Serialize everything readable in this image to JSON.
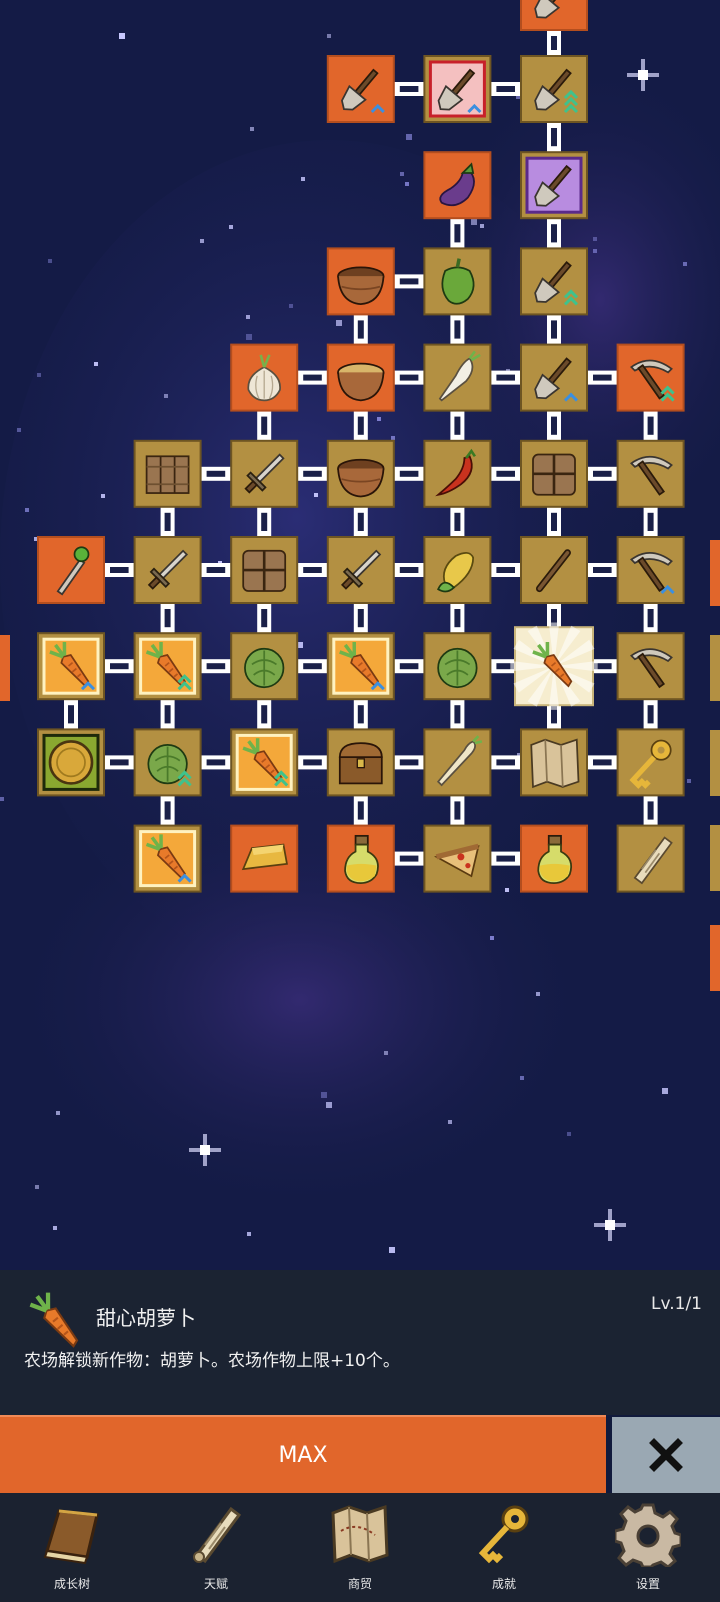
{
  "tree": {
    "nodes": [
      {
        "id": "a1",
        "col": 5,
        "row": 0,
        "icon": "shovel-icon",
        "style": "orange",
        "partial": true
      },
      {
        "id": "b3",
        "col": 3,
        "row": 1,
        "icon": "shovel-icon",
        "style": "orange",
        "arrows": 1
      },
      {
        "id": "b4",
        "col": 4,
        "row": 1,
        "icon": "shovel-icon",
        "style": "pink-frame",
        "arrows": 1
      },
      {
        "id": "b5",
        "col": 5,
        "row": 1,
        "icon": "shovel-icon",
        "style": "tan",
        "arrows": 3
      },
      {
        "id": "c4",
        "col": 4,
        "row": 2,
        "icon": "eggplant-icon",
        "style": "orange"
      },
      {
        "id": "c5",
        "col": 5,
        "row": 2,
        "icon": "shovel-icon",
        "style": "purple-frame"
      },
      {
        "id": "d3",
        "col": 3,
        "row": 3,
        "icon": "bowl-icon",
        "style": "orange"
      },
      {
        "id": "d4",
        "col": 4,
        "row": 3,
        "icon": "pepper-icon",
        "style": "tan"
      },
      {
        "id": "d5",
        "col": 5,
        "row": 3,
        "icon": "shovel-icon",
        "style": "tan",
        "arrows": 2
      },
      {
        "id": "e2",
        "col": 2,
        "row": 4,
        "icon": "garlic-icon",
        "style": "orange"
      },
      {
        "id": "e3",
        "col": 3,
        "row": 4,
        "icon": "soup-bowl-icon",
        "style": "orange"
      },
      {
        "id": "e4",
        "col": 4,
        "row": 4,
        "icon": "radish-icon",
        "style": "tan"
      },
      {
        "id": "e5",
        "col": 5,
        "row": 4,
        "icon": "shovel-icon",
        "style": "tan",
        "arrows": 1
      },
      {
        "id": "e6",
        "col": 6,
        "row": 4,
        "icon": "pickaxe-icon",
        "style": "orange",
        "arrows": 2
      },
      {
        "id": "f1",
        "col": 1,
        "row": 5,
        "icon": "wood-planks-icon",
        "style": "tan"
      },
      {
        "id": "f2",
        "col": 2,
        "row": 5,
        "icon": "sword-icon",
        "style": "tan"
      },
      {
        "id": "f3",
        "col": 3,
        "row": 5,
        "icon": "bowl-icon",
        "style": "tan"
      },
      {
        "id": "f4",
        "col": 4,
        "row": 5,
        "icon": "chili-icon",
        "style": "tan"
      },
      {
        "id": "f5",
        "col": 5,
        "row": 5,
        "icon": "crate-icon",
        "style": "tan"
      },
      {
        "id": "f6",
        "col": 6,
        "row": 5,
        "icon": "pickaxe-icon",
        "style": "tan"
      },
      {
        "id": "g0",
        "col": 0,
        "row": 6,
        "icon": "staff-icon",
        "style": "orange"
      },
      {
        "id": "g1",
        "col": 1,
        "row": 6,
        "icon": "sword-icon",
        "style": "tan"
      },
      {
        "id": "g2",
        "col": 2,
        "row": 6,
        "icon": "crate-icon",
        "style": "tan"
      },
      {
        "id": "g3",
        "col": 3,
        "row": 6,
        "icon": "sword-icon",
        "style": "tan"
      },
      {
        "id": "g4",
        "col": 4,
        "row": 6,
        "icon": "corn-icon",
        "style": "tan"
      },
      {
        "id": "g5",
        "col": 5,
        "row": 6,
        "icon": "stick-icon",
        "style": "tan"
      },
      {
        "id": "g6",
        "col": 6,
        "row": 6,
        "icon": "pickaxe-icon",
        "style": "tan",
        "arrows": 1
      },
      {
        "id": "h0",
        "col": 0,
        "row": 7,
        "icon": "carrot-icon",
        "style": "gold-frame",
        "arrows": 1
      },
      {
        "id": "h1",
        "col": 1,
        "row": 7,
        "icon": "carrot-icon",
        "style": "gold-frame",
        "arrows": 2
      },
      {
        "id": "h2",
        "col": 2,
        "row": 7,
        "icon": "cabbage-icon",
        "style": "tan"
      },
      {
        "id": "h3",
        "col": 3,
        "row": 7,
        "icon": "carrot-icon",
        "style": "gold-frame",
        "arrows": 1
      },
      {
        "id": "h4",
        "col": 4,
        "row": 7,
        "icon": "cabbage-icon",
        "style": "tan"
      },
      {
        "id": "h5",
        "col": 5,
        "row": 7,
        "icon": "carrot-icon",
        "style": "selected"
      },
      {
        "id": "h6",
        "col": 6,
        "row": 7,
        "icon": "pickaxe-icon",
        "style": "tan"
      },
      {
        "id": "i0",
        "col": 0,
        "row": 8,
        "icon": "coin-icon",
        "style": "green-frame"
      },
      {
        "id": "i1",
        "col": 1,
        "row": 8,
        "icon": "cabbage-icon",
        "style": "tan",
        "arrows": 2
      },
      {
        "id": "i2",
        "col": 2,
        "row": 8,
        "icon": "carrot-icon",
        "style": "gold-frame",
        "arrows": 2
      },
      {
        "id": "i3",
        "col": 3,
        "row": 8,
        "icon": "chest-icon",
        "style": "tan"
      },
      {
        "id": "i4",
        "col": 4,
        "row": 8,
        "icon": "parsnip-icon",
        "style": "tan"
      },
      {
        "id": "i5",
        "col": 5,
        "row": 8,
        "icon": "map-icon",
        "style": "tan"
      },
      {
        "id": "i6",
        "col": 6,
        "row": 8,
        "icon": "key-icon",
        "style": "tan"
      },
      {
        "id": "j1",
        "col": 1,
        "row": 9,
        "icon": "carrot-icon",
        "style": "gold-frame",
        "arrows": 1
      },
      {
        "id": "j2",
        "col": 2,
        "row": 9,
        "icon": "gold-bar-icon",
        "style": "orange"
      },
      {
        "id": "j3",
        "col": 3,
        "row": 9,
        "icon": "potion-icon",
        "style": "orange"
      },
      {
        "id": "j4",
        "col": 4,
        "row": 9,
        "icon": "pizza-icon",
        "style": "tan"
      },
      {
        "id": "j5",
        "col": 5,
        "row": 9,
        "icon": "potion-icon",
        "style": "orange"
      },
      {
        "id": "j6",
        "col": 6,
        "row": 9,
        "icon": "scroll-icon",
        "style": "tan"
      }
    ],
    "links": [
      [
        "a1",
        "b5"
      ],
      [
        "b3",
        "b4"
      ],
      [
        "b4",
        "b5"
      ],
      [
        "b5",
        "c5"
      ],
      [
        "c4",
        "d4"
      ],
      [
        "c5",
        "d5"
      ],
      [
        "d3",
        "d4"
      ],
      [
        "d3",
        "e3"
      ],
      [
        "d4",
        "e4"
      ],
      [
        "d5",
        "e5"
      ],
      [
        "e2",
        "e3"
      ],
      [
        "e3",
        "e4"
      ],
      [
        "e4",
        "e5"
      ],
      [
        "e5",
        "e6"
      ],
      [
        "e2",
        "f2"
      ],
      [
        "e3",
        "f3"
      ],
      [
        "e4",
        "f4"
      ],
      [
        "e5",
        "f5"
      ],
      [
        "e6",
        "f6"
      ],
      [
        "f1",
        "f2"
      ],
      [
        "f2",
        "f3"
      ],
      [
        "f3",
        "f4"
      ],
      [
        "f4",
        "f5"
      ],
      [
        "f5",
        "f6"
      ],
      [
        "f1",
        "g1"
      ],
      [
        "f2",
        "g2"
      ],
      [
        "f3",
        "g3"
      ],
      [
        "f4",
        "g4"
      ],
      [
        "f5",
        "g5"
      ],
      [
        "f6",
        "g6"
      ],
      [
        "g0",
        "g1"
      ],
      [
        "g1",
        "g2"
      ],
      [
        "g2",
        "g3"
      ],
      [
        "g3",
        "g4"
      ],
      [
        "g4",
        "g5"
      ],
      [
        "g5",
        "g6"
      ],
      [
        "g1",
        "h1"
      ],
      [
        "g2",
        "h2"
      ],
      [
        "g3",
        "h3"
      ],
      [
        "g4",
        "h4"
      ],
      [
        "g5",
        "h5"
      ],
      [
        "g6",
        "h6"
      ],
      [
        "h0",
        "h1"
      ],
      [
        "h1",
        "h2"
      ],
      [
        "h2",
        "h3"
      ],
      [
        "h3",
        "h4"
      ],
      [
        "h4",
        "h5"
      ],
      [
        "h5",
        "h6"
      ],
      [
        "h0",
        "i0"
      ],
      [
        "h1",
        "i1"
      ],
      [
        "h2",
        "i2"
      ],
      [
        "h3",
        "i3"
      ],
      [
        "h4",
        "i4"
      ],
      [
        "h5",
        "i5"
      ],
      [
        "h6",
        "i6"
      ],
      [
        "i0",
        "i1"
      ],
      [
        "i1",
        "i2"
      ],
      [
        "i2",
        "i3"
      ],
      [
        "i3",
        "i4"
      ],
      [
        "i4",
        "i5"
      ],
      [
        "i5",
        "i6"
      ],
      [
        "i1",
        "j1"
      ],
      [
        "i3",
        "j3"
      ],
      [
        "i4",
        "j4"
      ],
      [
        "i6",
        "j6"
      ],
      [
        "j3",
        "j4"
      ],
      [
        "j4",
        "j5"
      ]
    ]
  },
  "detail": {
    "icon": "carrot-icon",
    "title": "甜心胡萝卜",
    "level": "Lv.1/1",
    "description": "农场解锁新作物：胡萝卜。农场作物上限+10个。"
  },
  "actions": {
    "max_label": "MAX",
    "close_icon": "close-icon"
  },
  "nav": {
    "items": [
      {
        "label": "成长树",
        "icon": "book-icon"
      },
      {
        "label": "天赋",
        "icon": "scroll-icon"
      },
      {
        "label": "商贸",
        "icon": "map-icon"
      },
      {
        "label": "成就",
        "icon": "key-icon"
      },
      {
        "label": "设置",
        "icon": "gear-icon"
      }
    ]
  },
  "colors": {
    "orange_tile": "#e1662b",
    "tan_tile": "#b39042",
    "panel_bg": "#1b2332",
    "max_button": "#e1662b",
    "close_button": "#9aa8b3",
    "arrow_blue": "#3b8fe0",
    "arrow_green": "#3fc28c"
  }
}
